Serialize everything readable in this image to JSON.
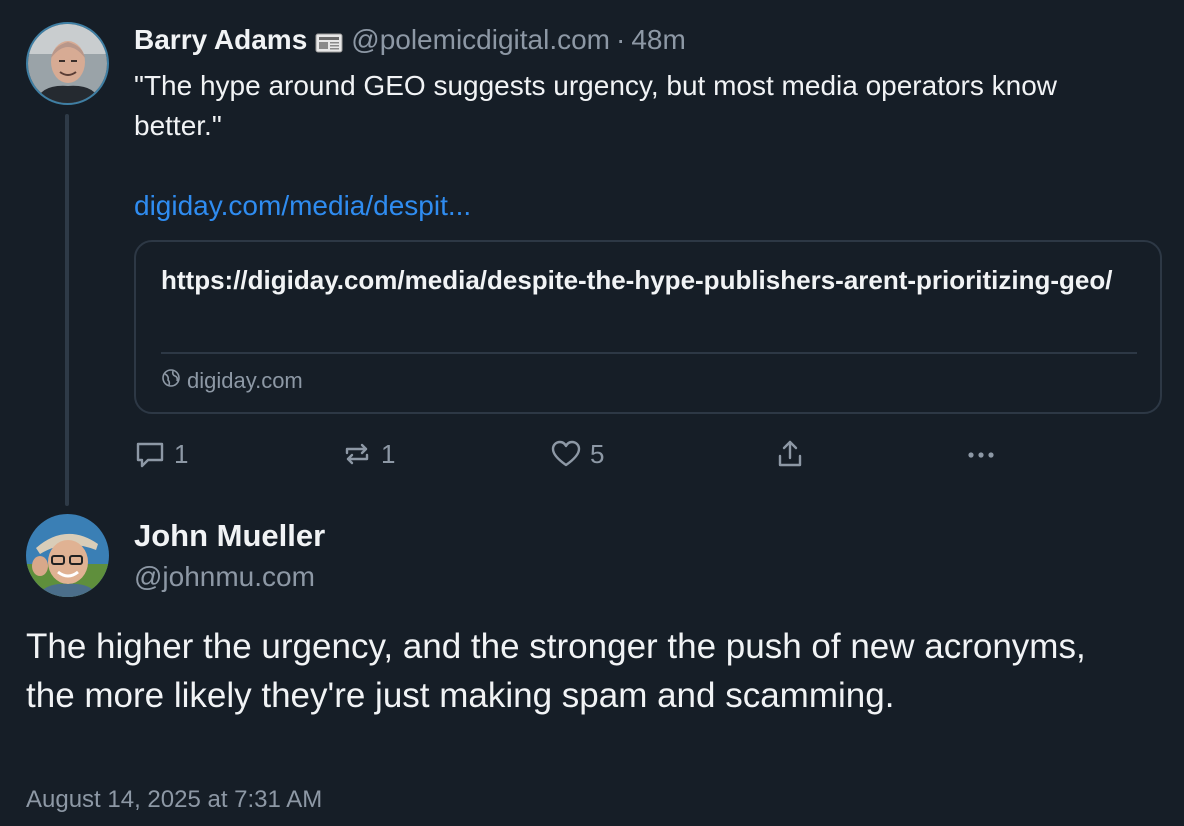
{
  "parent_post": {
    "author_name": "Barry Adams",
    "author_emoji": "newspaper-emoji",
    "handle": "@polemicdigital.com",
    "separator": "·",
    "time_ago": "48m",
    "text": "\"The hype around GEO suggests urgency, but most media operators know better.\"",
    "link_text": "digiday.com/media/despit...",
    "card": {
      "url": "https://digiday.com/media/despite-the-hype-publishers-arent-prioritizing-geo/",
      "domain": "digiday.com",
      "domain_icon": "globe-icon"
    },
    "actions": {
      "reply_count": "1",
      "repost_count": "1",
      "like_count": "5"
    }
  },
  "main_post": {
    "author_name": "John Mueller",
    "handle": "@johnmu.com",
    "text": "The higher the urgency, and the stronger the push of new acronyms, the more likely they're just making spam and scamming.",
    "date": "August 14, 2025 at 7:31 AM"
  },
  "colors": {
    "background": "#161e27",
    "text": "#f1f3f5",
    "muted": "#8d98a5",
    "link": "#2f8cf0",
    "border": "#2d3845"
  }
}
